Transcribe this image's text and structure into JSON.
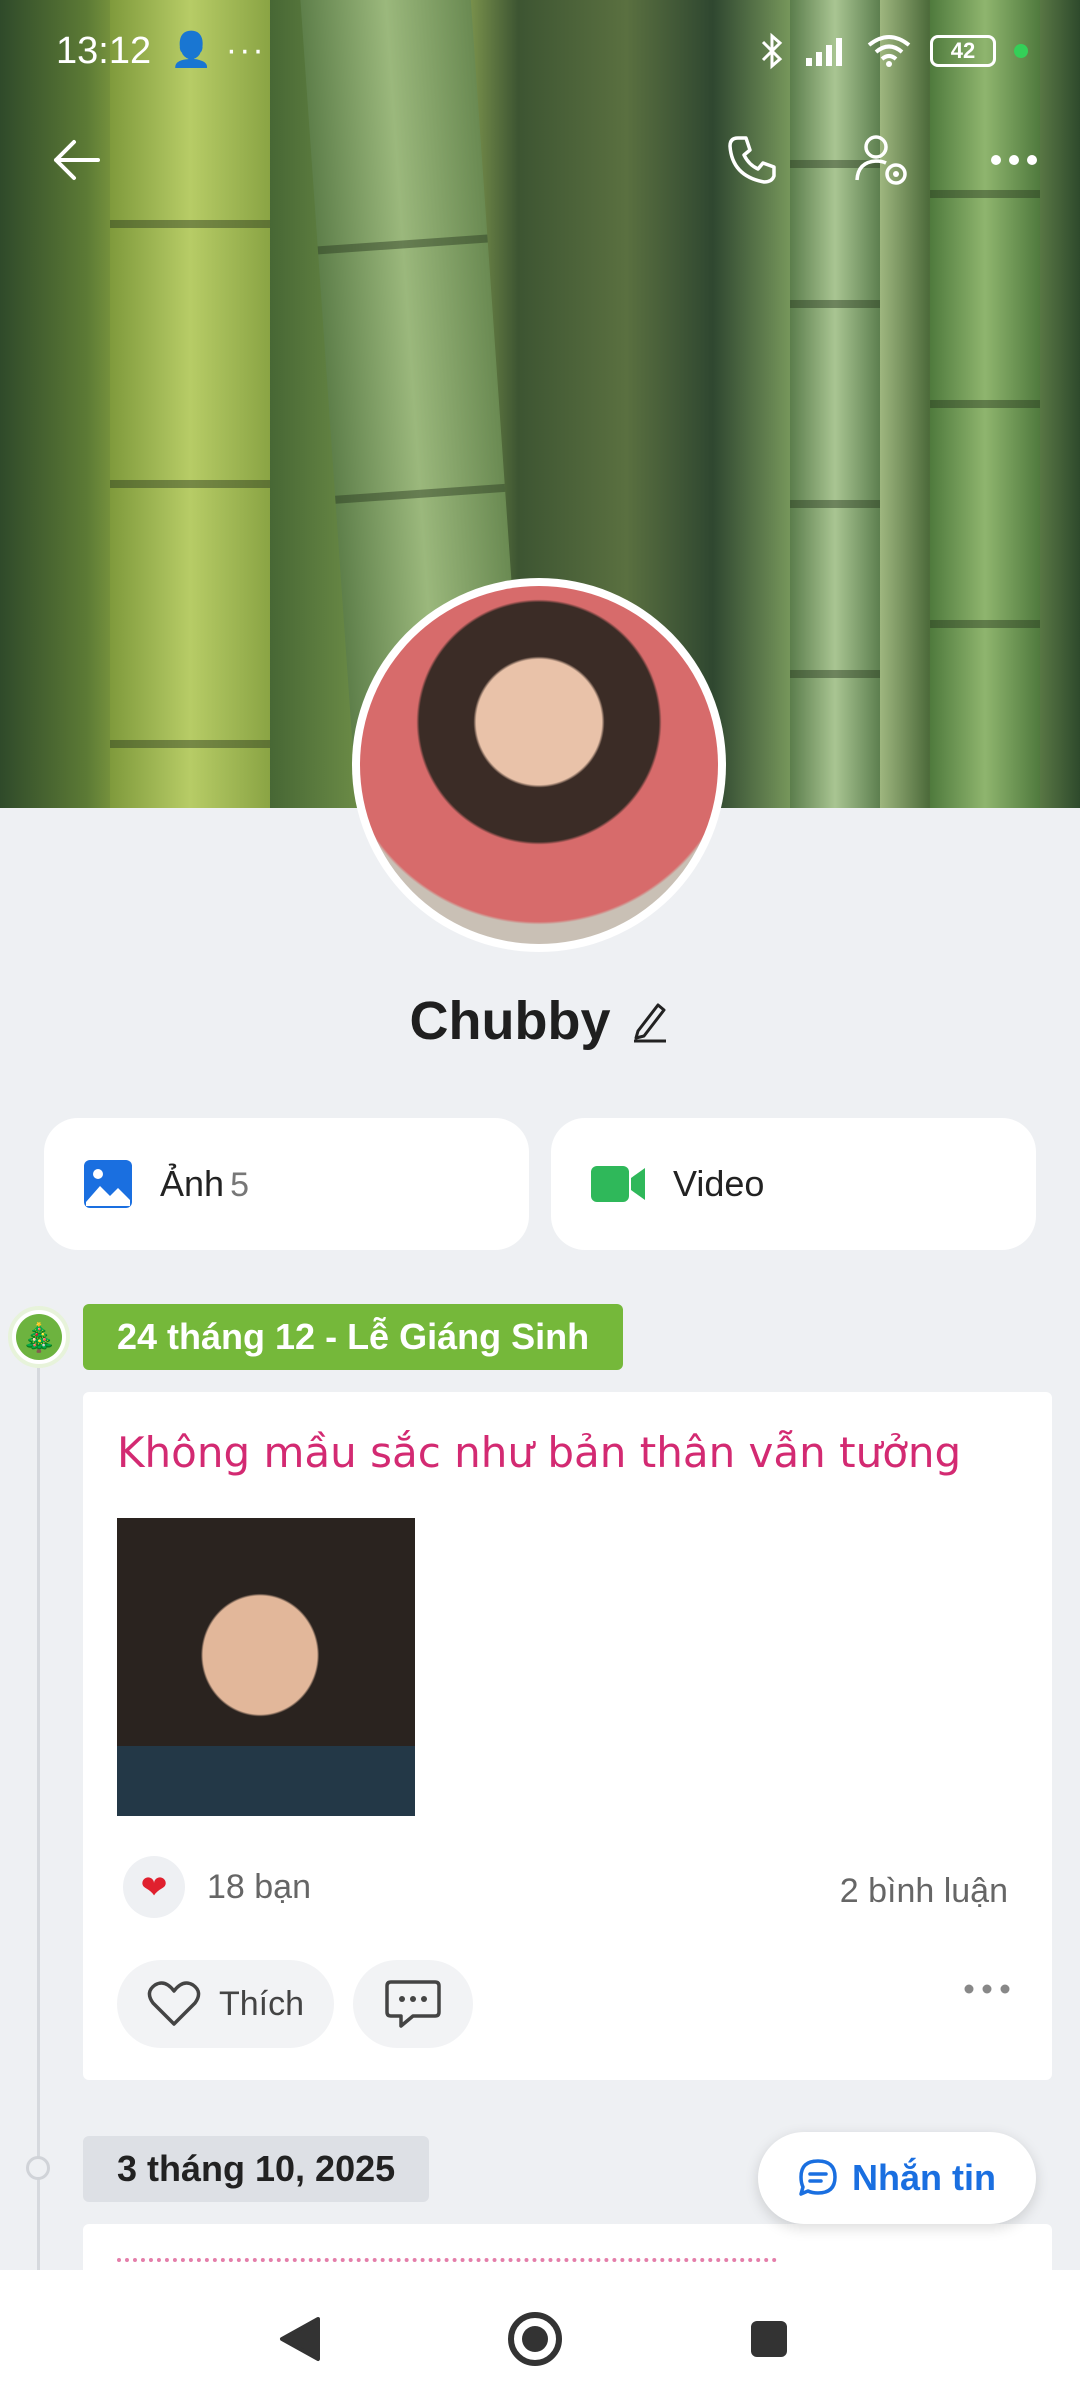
{
  "status_bar": {
    "time": "13:12",
    "left_icons": "👤 ···",
    "battery": "42"
  },
  "profile": {
    "name": "Chubby"
  },
  "media": {
    "photos": {
      "label": "Ảnh",
      "count": "5"
    },
    "video": {
      "label": "Video"
    }
  },
  "feed": {
    "post1": {
      "date": "24 tháng 12 - Lễ Giáng Sinh",
      "caption": "Không mầu sắc như bản thân vẫn tưởng",
      "reactions": "18 bạn",
      "comments": "2 bình luận",
      "like_label": "Thích"
    },
    "post2": {
      "date": "3 tháng 10, 2025"
    }
  },
  "fab": {
    "message_label": "Nhắn tin"
  },
  "colors": {
    "accent": "#1a6fe0",
    "holiday_badge": "#75b83a",
    "caption": "#d32a72"
  }
}
